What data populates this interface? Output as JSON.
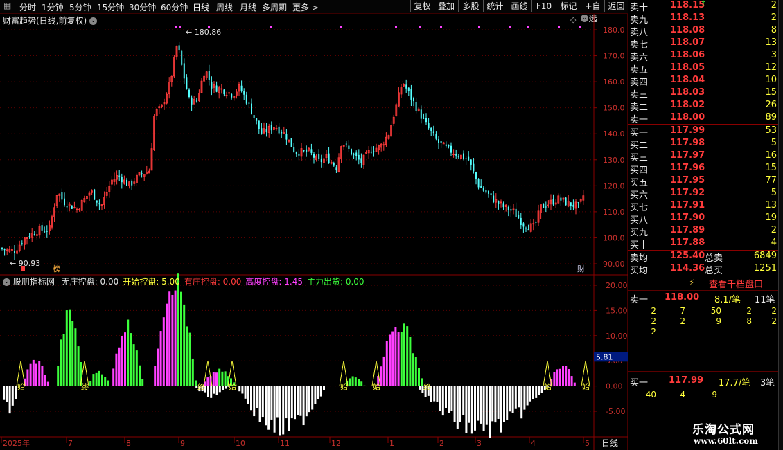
{
  "toolbar": {
    "periods": [
      "分时",
      "1分钟",
      "5分钟",
      "15分钟",
      "30分钟",
      "60分钟",
      "日线",
      "周线",
      "月线",
      "多周期",
      "更多 >"
    ],
    "active_period": "日线",
    "buttons": [
      "复权",
      "叠加",
      "多股",
      "统计",
      "画线",
      "F10",
      "标记",
      "+自选",
      "返回"
    ]
  },
  "main_chart": {
    "title": "财富趋势(日线,前复权)",
    "high_label": "180.86",
    "low_label": "90.93",
    "marker_bang": "榜",
    "marker_cai": "财",
    "y_ticks": [
      "180.0",
      "170.0",
      "160.0",
      "150.0",
      "140.0",
      "130.0",
      "120.0",
      "110.0",
      "100.0",
      "90.00"
    ]
  },
  "indicator": {
    "name": "股朋指标网",
    "items": [
      {
        "label": "无庄控盘: 0.00",
        "color": "#e0e0e0"
      },
      {
        "label": "开始控盘: 5.00",
        "color": "#ffff3c"
      },
      {
        "label": "有庄控盘: 0.00",
        "color": "#ff3b3b"
      },
      {
        "label": "高度控盘: 1.45",
        "color": "#ff40ff"
      },
      {
        "label": "主力出货: 0.00",
        "color": "#3cff3c"
      }
    ],
    "y_ticks": [
      "20.00",
      "15.00",
      "10.00",
      "5.00",
      "0.00",
      "-5.00"
    ],
    "current_value": "5.81",
    "tags": [
      "始",
      "终"
    ]
  },
  "x_axis": {
    "labels": [
      "2025年",
      "7",
      "8",
      "9",
      "10",
      "11",
      "12",
      "1",
      "2",
      "3",
      "4",
      "5"
    ],
    "period_label": "日线"
  },
  "order_book": {
    "asks": [
      {
        "label": "卖十",
        "price": "118.15",
        "vol": "2"
      },
      {
        "label": "卖九",
        "price": "118.13",
        "vol": "2"
      },
      {
        "label": "卖八",
        "price": "118.08",
        "vol": "8"
      },
      {
        "label": "卖七",
        "price": "118.07",
        "vol": "13"
      },
      {
        "label": "卖六",
        "price": "118.06",
        "vol": "3"
      },
      {
        "label": "卖五",
        "price": "118.05",
        "vol": "12"
      },
      {
        "label": "卖四",
        "price": "118.04",
        "vol": "10"
      },
      {
        "label": "卖三",
        "price": "118.03",
        "vol": "15"
      },
      {
        "label": "卖二",
        "price": "118.02",
        "vol": "26"
      },
      {
        "label": "卖一",
        "price": "118.00",
        "vol": "89"
      }
    ],
    "bids": [
      {
        "label": "买一",
        "price": "117.99",
        "vol": "53"
      },
      {
        "label": "买二",
        "price": "117.98",
        "vol": "5"
      },
      {
        "label": "买三",
        "price": "117.97",
        "vol": "16"
      },
      {
        "label": "买四",
        "price": "117.96",
        "vol": "15"
      },
      {
        "label": "买五",
        "price": "117.95",
        "vol": "77"
      },
      {
        "label": "买六",
        "price": "117.92",
        "vol": "5"
      },
      {
        "label": "买七",
        "price": "117.91",
        "vol": "13"
      },
      {
        "label": "买八",
        "price": "117.90",
        "vol": "19"
      },
      {
        "label": "买九",
        "price": "117.89",
        "vol": "2"
      },
      {
        "label": "买十",
        "price": "117.88",
        "vol": "4"
      }
    ],
    "avg_sell": {
      "label": "卖均",
      "price": "125.40",
      "total_label": "总卖",
      "total": "6849"
    },
    "avg_buy": {
      "label": "买均",
      "price": "114.36",
      "total_label": "总买",
      "total": "1251"
    }
  },
  "detail": {
    "button": "查看千档盘口",
    "sell1": {
      "label": "卖一",
      "price": "118.00",
      "per": "8.1/笔",
      "count": "11笔",
      "rows": [
        [
          "2",
          "7",
          "50",
          "2",
          "2"
        ],
        [
          "2",
          "2",
          "9",
          "8",
          "2"
        ],
        [
          "2"
        ]
      ]
    },
    "buy1": {
      "label": "买一",
      "price": "117.99",
      "per": "17.7/笔",
      "count": "3笔",
      "rows": [
        [
          "40",
          "4",
          "9"
        ]
      ]
    }
  },
  "watermark": {
    "line1": "乐淘公式网",
    "line2": "www.60lt.com"
  },
  "colors": {
    "up": "#ff3b3b",
    "down": "#54ffff",
    "grid": "#5a0000",
    "bg": "#000000"
  }
}
